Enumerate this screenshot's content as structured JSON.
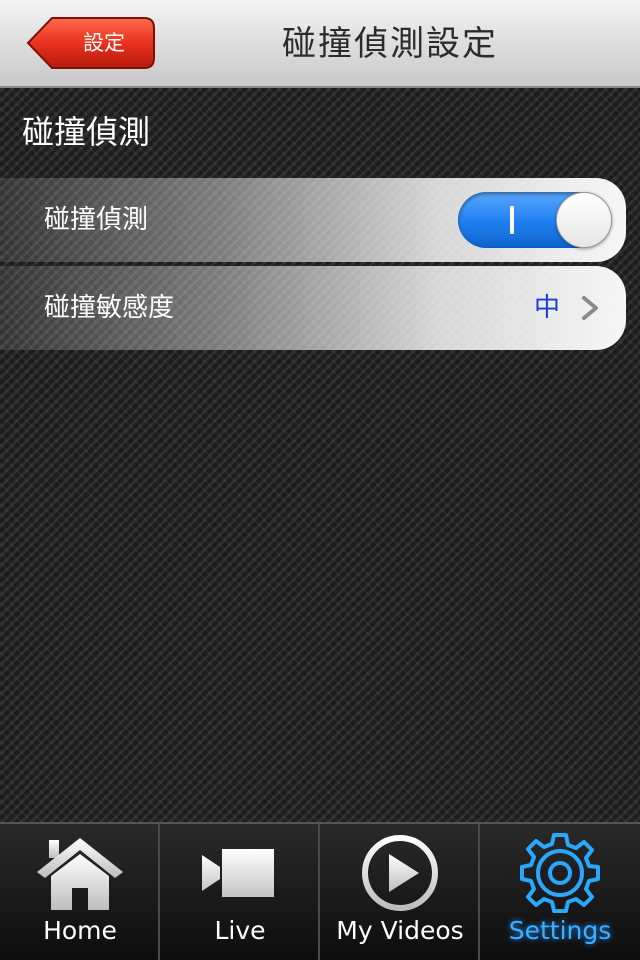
{
  "navbar": {
    "back_label": "設定",
    "title": "碰撞偵測設定"
  },
  "section": {
    "header": "碰撞偵測",
    "rows": [
      {
        "label": "碰撞偵測",
        "control": "toggle",
        "on": true
      },
      {
        "label": "碰撞敏感度",
        "value": "中"
      }
    ]
  },
  "tabbar": {
    "tabs": [
      {
        "label": "Home",
        "icon": "home-icon",
        "active": false
      },
      {
        "label": "Live",
        "icon": "video-camera-icon",
        "active": false
      },
      {
        "label": "My Videos",
        "icon": "play-icon",
        "active": false
      },
      {
        "label": "Settings",
        "icon": "gear-icon",
        "active": true
      }
    ]
  },
  "colors": {
    "back_button": "#e8321e",
    "toggle_on": "#1f7ff0",
    "row_value": "#1a3fd6",
    "tab_active": "#3fb0ff"
  }
}
